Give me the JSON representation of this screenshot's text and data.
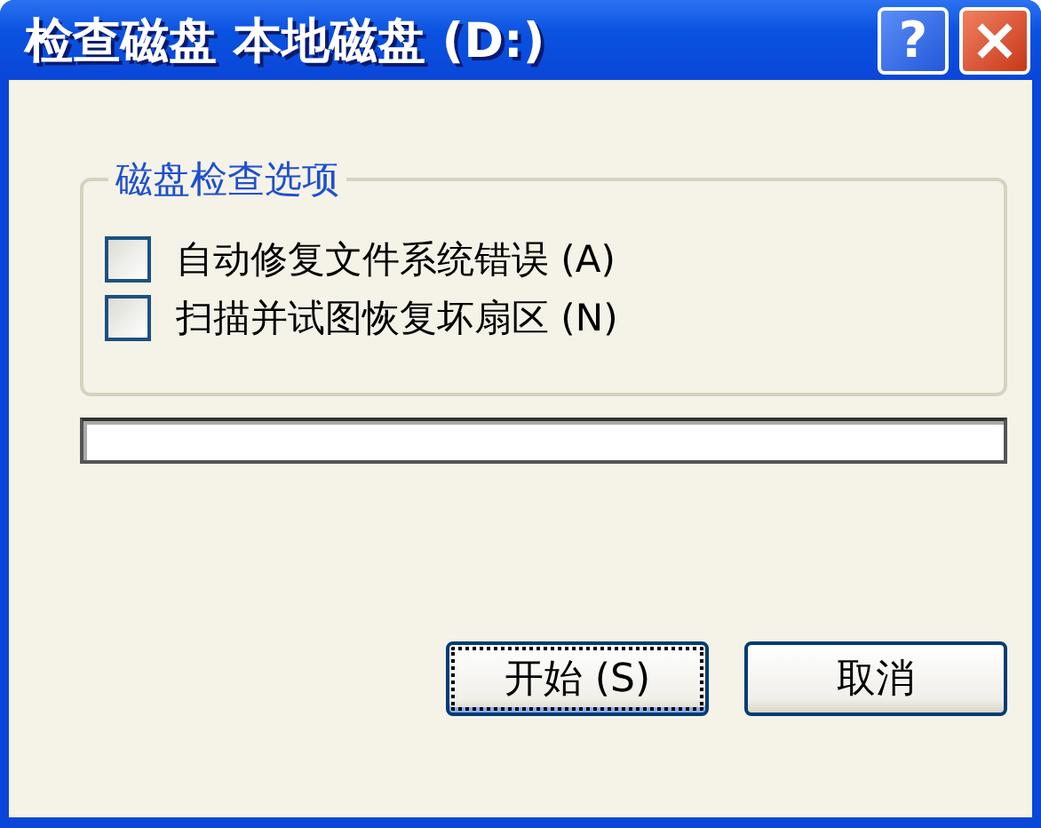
{
  "window": {
    "title": "检查磁盘 本地磁盘 (D:)",
    "help_button": "?"
  },
  "group": {
    "legend": "磁盘检查选项",
    "options": [
      {
        "label": "自动修复文件系统错误 (A)",
        "checked": false
      },
      {
        "label": "扫描并试图恢复坏扇区 (N)",
        "checked": false
      }
    ]
  },
  "progress": {
    "level": 0
  },
  "buttons": [
    {
      "label": "开始 (S)",
      "focused": true
    },
    {
      "label": "取消",
      "focused": false
    }
  ]
}
